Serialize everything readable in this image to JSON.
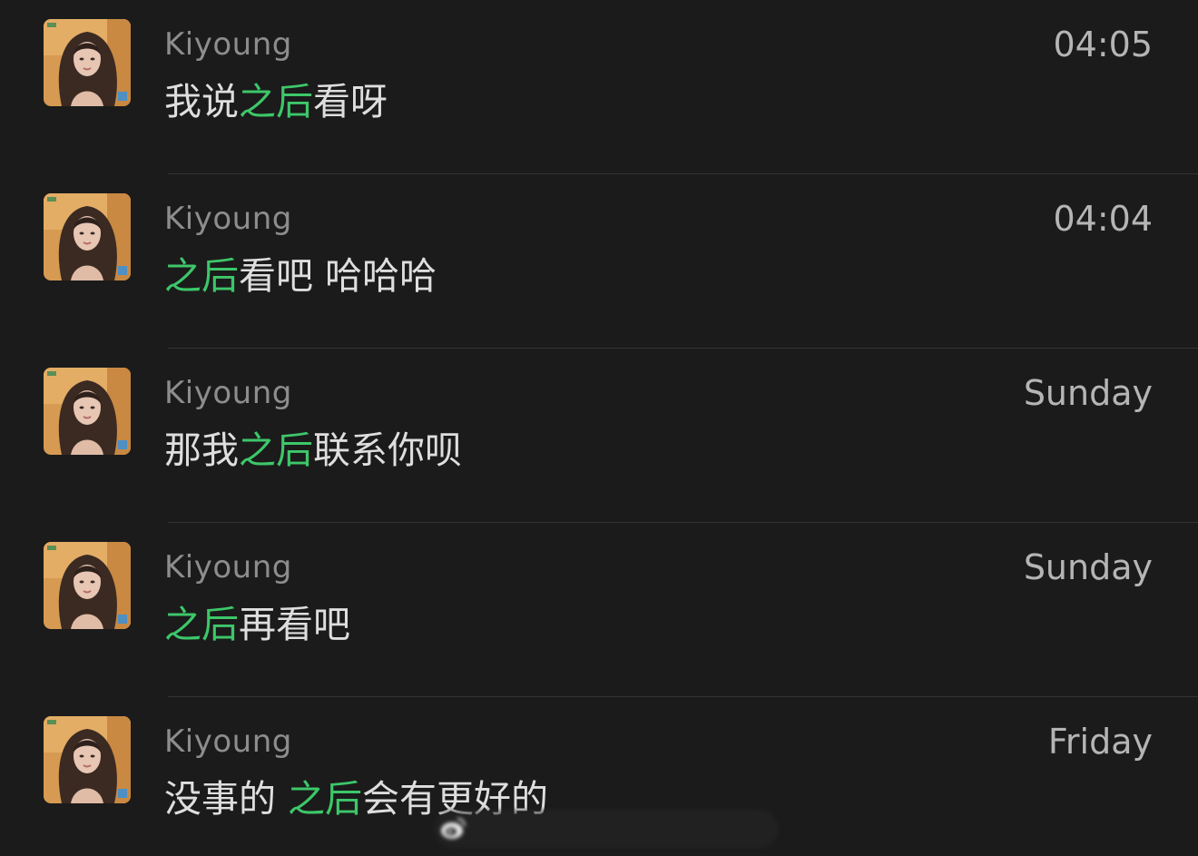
{
  "colors": {
    "background": "#1b1b1b",
    "highlight": "#3dc76a",
    "name_text": "#8d8d8d",
    "message_text": "#dedede",
    "time_text": "#b5b5b5",
    "divider": "#333333"
  },
  "results": [
    {
      "name": "Kiyoung",
      "time": "04:05",
      "message": {
        "before": "我说",
        "match": "之后",
        "after": "看呀"
      }
    },
    {
      "name": "Kiyoung",
      "time": "04:04",
      "message": {
        "before": "",
        "match": "之后",
        "after": "看吧 哈哈哈"
      }
    },
    {
      "name": "Kiyoung",
      "time": "Sunday",
      "message": {
        "before": "那我",
        "match": "之后",
        "after": "联系你呗"
      }
    },
    {
      "name": "Kiyoung",
      "time": "Sunday",
      "message": {
        "before": "",
        "match": "之后",
        "after": "再看吧"
      }
    },
    {
      "name": "Kiyoung",
      "time": "Friday",
      "message": {
        "before": "没事的 ",
        "match": "之后",
        "after": "会有更好的"
      }
    }
  ],
  "avatar_icon": "profile-photo-icon",
  "watermark_icon": "weibo-logo-icon"
}
